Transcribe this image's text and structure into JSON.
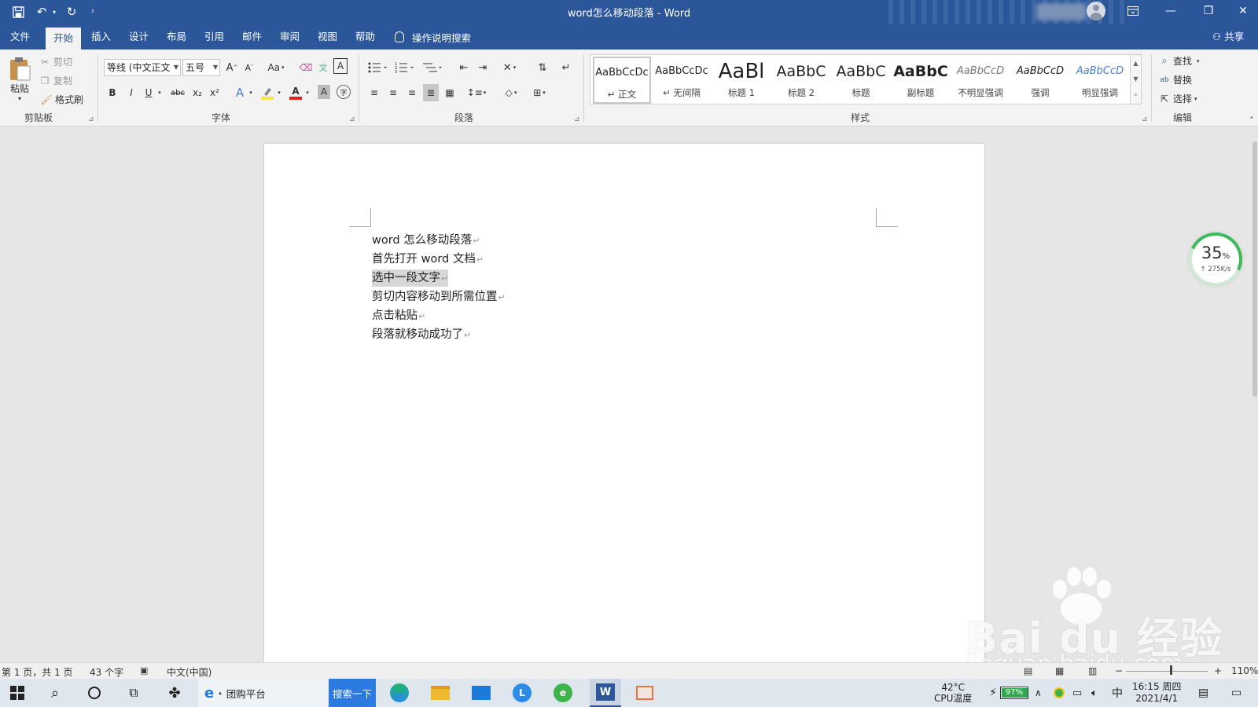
{
  "window": {
    "title": "word怎么移动段落  -  Word"
  },
  "quick_access": {
    "save_icon": "save-icon",
    "undo_icon": "undo-icon",
    "redo_icon": "redo-icon",
    "customize_icon": "customize-icon"
  },
  "window_controls": {
    "ribbon_display_icon": "ribbon-display-icon",
    "minimize": "—",
    "restore": "❐",
    "close": "✕"
  },
  "tabs": [
    {
      "label": "文件"
    },
    {
      "label": "开始"
    },
    {
      "label": "插入"
    },
    {
      "label": "设计"
    },
    {
      "label": "布局"
    },
    {
      "label": "引用"
    },
    {
      "label": "邮件"
    },
    {
      "label": "审阅"
    },
    {
      "label": "视图"
    },
    {
      "label": "帮助"
    }
  ],
  "tell_me": "操作说明搜索",
  "share": "共享",
  "clipboard": {
    "paste": "粘贴",
    "cut": "剪切",
    "copy": "复制",
    "format_painter": "格式刷",
    "group_label": "剪贴板"
  },
  "font": {
    "font_name": "等线 (中文正文",
    "font_size": "五号",
    "grow": "A",
    "shrink": "A",
    "change_case": "Aa",
    "bold": "B",
    "italic": "I",
    "underline": "U",
    "strikethrough": "abc",
    "subscript": "x₂",
    "superscript": "x²",
    "text_effects": "A",
    "font_color": "A",
    "char_shading": "A",
    "enclose": "字",
    "phonetic": "文",
    "border": "A",
    "group_label": "字体",
    "font_color_hex": "#e02020",
    "highlight_hex": "#f5e642"
  },
  "paragraph": {
    "group_label": "段落"
  },
  "styles": {
    "group_label": "样式",
    "items": [
      {
        "preview": "AaBbCcDc",
        "name": "↵ 正文"
      },
      {
        "preview": "AaBbCcDc",
        "name": "↵ 无间隔"
      },
      {
        "preview": "AaBl",
        "name": "标题 1"
      },
      {
        "preview": "AaBbC",
        "name": "标题 2"
      },
      {
        "preview": "AaBbC",
        "name": "标题"
      },
      {
        "preview": "AaBbC",
        "name": "副标题"
      },
      {
        "preview": "AaBbCcD",
        "name": "不明显强调"
      },
      {
        "preview": "AaBbCcD",
        "name": "强调"
      },
      {
        "preview": "AaBbCcD",
        "name": "明显强调"
      }
    ]
  },
  "editing": {
    "find": "查找",
    "replace": "替换",
    "select": "选择",
    "group_label": "编辑"
  },
  "document": {
    "lines": [
      {
        "text": "word 怎么移动段落"
      },
      {
        "text": "首先打开 word 文档"
      },
      {
        "text": "选中一段文字",
        "selected": true
      },
      {
        "text": "剪切内容移动到所需位置"
      },
      {
        "text": "点击粘贴"
      },
      {
        "text": "段落就移动成功了"
      }
    ],
    "paragraph_mark": "↵"
  },
  "net_widget": {
    "percent": "35",
    "percent_unit": "%",
    "speed": "↑ 275K/s"
  },
  "status": {
    "page": "第 1 页，共 1 页",
    "words": "43 个字",
    "language": "中文(中国)",
    "zoom": "110%",
    "zoom_minus": "−",
    "zoom_plus": "+"
  },
  "watermark": {
    "brand": "Bai du 经验",
    "url": "jingyan.baidu.com"
  },
  "taskbar": {
    "ie_label": "团购平台",
    "search_button": "搜索一下",
    "temp": "42°C",
    "temp_label": "CPU温度",
    "battery": "97%",
    "ime": "中",
    "time": "16:15 周四",
    "date": "2021/4/1"
  }
}
